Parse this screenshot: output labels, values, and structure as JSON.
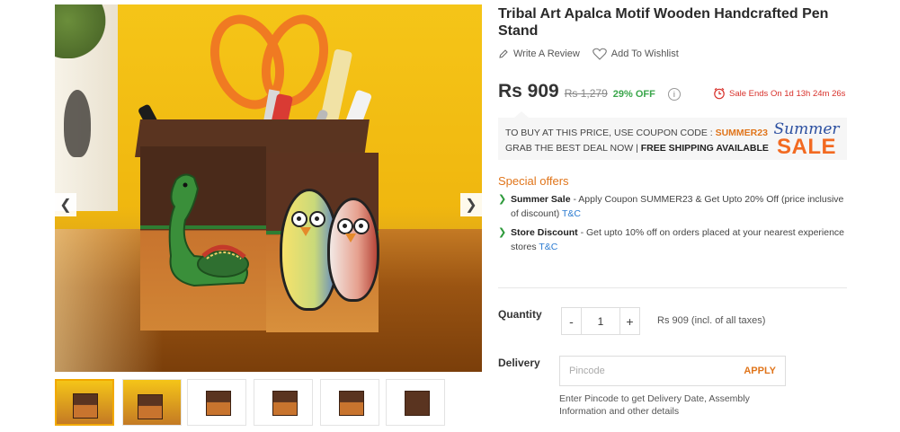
{
  "product": {
    "title": "Tribal Art Apalca Motif Wooden Handcrafted Pen Stand",
    "write_review": "Write A Review",
    "add_wishlist": "Add To Wishlist"
  },
  "pricing": {
    "price": "Rs 909",
    "mrp": "Rs 1,279",
    "discount": "29% OFF",
    "info": "i",
    "sale_ends": "Sale Ends On 1d 13h 24m 26s"
  },
  "coupon": {
    "line1_prefix": "TO BUY AT THIS PRICE, USE COUPON CODE : ",
    "code": "SUMMER23",
    "line2_prefix": "GRAB THE BEST DEAL NOW | ",
    "line2_bold": "FREE SHIPPING AVAILABLE",
    "banner_script": "Summer",
    "banner_big": "SALE"
  },
  "offers": {
    "title": "Special offers",
    "items": [
      {
        "name": "Summer Sale",
        "text": " - Apply Coupon SUMMER23 & Get Upto 20% Off (price inclusive of discount) ",
        "link": "T&C"
      },
      {
        "name": "Store Discount",
        "text": " - Get upto 10% off on orders placed at your nearest experience stores ",
        "link": "T&C"
      }
    ]
  },
  "quantity": {
    "label": "Quantity",
    "minus": "-",
    "value": "1",
    "plus": "+",
    "price_note": "Rs 909 (incl. of all taxes)"
  },
  "delivery": {
    "label": "Delivery",
    "placeholder": "Pincode",
    "apply": "APPLY",
    "note": "Enter Pincode to get Delivery Date, Assembly Information and other details"
  },
  "gallery": {
    "prev": "❮",
    "next": "❯",
    "thumbnail_count": 6,
    "active_thumbnail": 1
  },
  "colors": {
    "accent_orange": "#e0751b",
    "sale_red": "#d8312b",
    "discount_green": "#3aa64b",
    "link_blue": "#2b7bd1"
  }
}
